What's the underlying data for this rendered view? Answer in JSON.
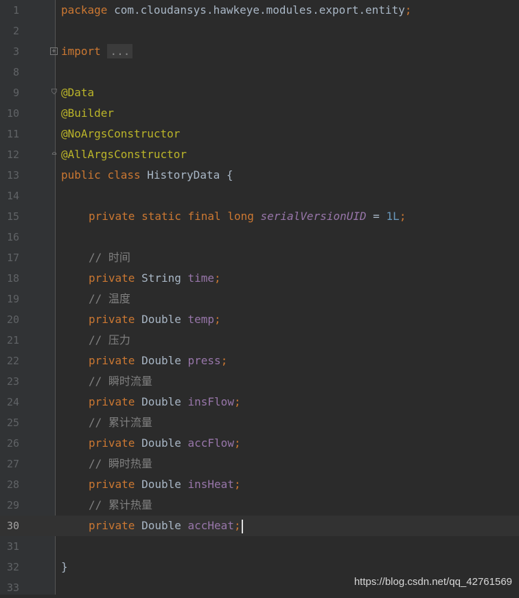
{
  "editor": {
    "package": {
      "kw": "package",
      "name": "com.cloudansys.hawkeye.modules.export.entity",
      "semi": ";"
    },
    "import": {
      "kw": "import",
      "placeholder": "..."
    },
    "annotations": [
      "@Data",
      "@Builder",
      "@NoArgsConstructor",
      "@AllArgsConstructor"
    ],
    "class_decl": {
      "kw1": "public",
      "kw2": "class",
      "name": "HistoryData",
      "brace": "{"
    },
    "serial": {
      "kw1": "private",
      "kw2": "static",
      "kw3": "final",
      "kw4": "long",
      "name": "serialVersionUID",
      "eq": "=",
      "value": "1L",
      "semi": ";"
    },
    "fields": [
      {
        "comment": "// 时间",
        "kw": "private",
        "type": "String",
        "name": "time",
        "semi": ";"
      },
      {
        "comment": "// 温度",
        "kw": "private",
        "type": "Double",
        "name": "temp",
        "semi": ";"
      },
      {
        "comment": "// 压力",
        "kw": "private",
        "type": "Double",
        "name": "press",
        "semi": ";"
      },
      {
        "comment": "// 瞬时流量",
        "kw": "private",
        "type": "Double",
        "name": "insFlow",
        "semi": ";"
      },
      {
        "comment": "// 累计流量",
        "kw": "private",
        "type": "Double",
        "name": "accFlow",
        "semi": ";"
      },
      {
        "comment": "// 瞬时热量",
        "kw": "private",
        "type": "Double",
        "name": "insHeat",
        "semi": ";"
      },
      {
        "comment": "// 累计热量",
        "kw": "private",
        "type": "Double",
        "name": "accHeat",
        "semi": ";"
      }
    ],
    "closing_brace": "}",
    "line_numbers": [
      "1",
      "2",
      "3",
      "8",
      "9",
      "10",
      "11",
      "12",
      "13",
      "14",
      "15",
      "16",
      "17",
      "18",
      "19",
      "20",
      "21",
      "22",
      "23",
      "24",
      "25",
      "26",
      "27",
      "28",
      "29",
      "30",
      "31",
      "32",
      "33"
    ],
    "current_line": "30"
  },
  "watermark": "https://blog.csdn.net/qq_42761569"
}
